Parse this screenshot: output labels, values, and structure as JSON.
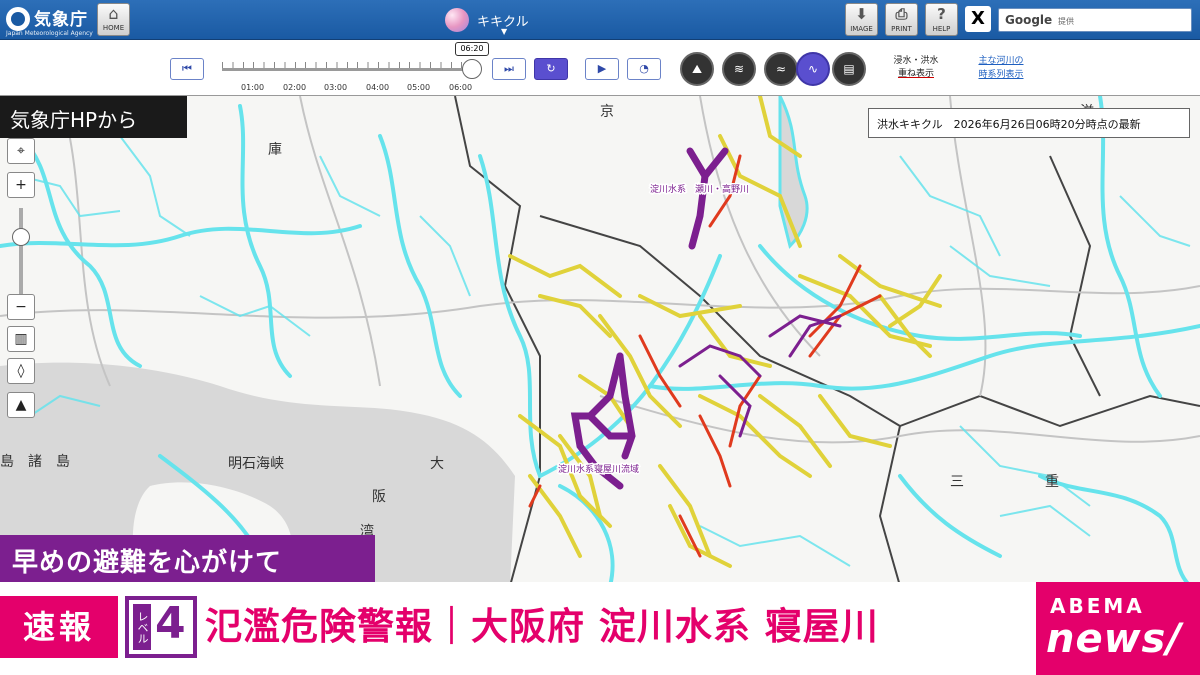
{
  "header": {
    "agency_name": "気象庁",
    "agency_sub": "Japan Meteorological Agency",
    "home_label": "HOME",
    "app_title": "キキクル",
    "image_label": "IMAGE",
    "print_label": "PRINT",
    "help_label": "HELP",
    "x_label": "X",
    "search_brand": "Google",
    "search_suffix": "提供"
  },
  "controls": {
    "current_time": "06:20",
    "time_labels": [
      "01:00",
      "02:00",
      "03:00",
      "04:00",
      "05:00",
      "06:00"
    ],
    "overlay_label_1": "浸水・洪水",
    "overlay_label_2": "重ね表示",
    "series_link_1": "主な河川の",
    "series_link_2": "時系列表示"
  },
  "map": {
    "source_tag": "気象庁HPから",
    "info_panel": "洪水キキクル　2026年6月26日06時20分時点の最新",
    "river_label_1": "淀川水系　瀬川・高野川",
    "river_label_2": "淀川水系寝屋川流域",
    "place_labels": [
      "明石海峡",
      "大",
      "阪",
      "島",
      "諸",
      "島",
      "湾",
      "三",
      "重",
      "庫",
      "滋",
      "京"
    ]
  },
  "colors": {
    "level_purple": "#7c1f8f",
    "level_red": "#e03a1e",
    "level_yellow": "#e0d23a",
    "river_cyan": "#66e3ec",
    "brand_pink": "#e4006b"
  },
  "news": {
    "subcaption": "早めの避難を心がけて",
    "breaking": "速報",
    "level_prefix": "レベル",
    "level_number": "4",
    "headline": "氾濫危険警報｜大阪府 淀川水系 寝屋川",
    "brand_top": "ABEMA",
    "brand_bottom": "news/"
  }
}
